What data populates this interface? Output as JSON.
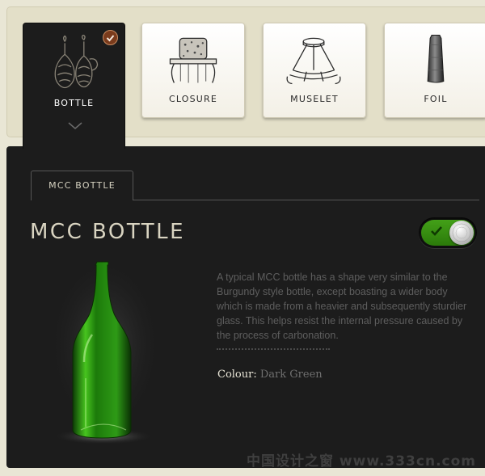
{
  "categories": [
    {
      "label": "BOTTLE",
      "icon": "bottle-icon",
      "selected": true
    },
    {
      "label": "CLOSURE",
      "icon": "cork-icon",
      "selected": false
    },
    {
      "label": "MUSELET",
      "icon": "muselet-icon",
      "selected": false
    },
    {
      "label": "FOIL",
      "icon": "foil-icon",
      "selected": false
    }
  ],
  "subtabs": [
    {
      "label": "MCC BOTTLE",
      "active": true
    }
  ],
  "product": {
    "title": "MCC BOTTLE",
    "toggle_on": true,
    "description": "A typical MCC bottle has a shape very similar to the Burgundy style bottle, except boasting a wider body which is made from a heavier and subsequently sturdier glass. This helps resist the internal pressure caused by the process of carbonation.",
    "colour_label": "Colour:",
    "colour_value": "Dark Green"
  },
  "watermark": "中国设计之窗 www.333cn.com",
  "colors": {
    "panel": "#1c1c1c",
    "band": "#e3dfc8",
    "toggle_green": "#3a9413",
    "badge": "#7a3b1c",
    "bottle_green": "#2e9a16"
  }
}
